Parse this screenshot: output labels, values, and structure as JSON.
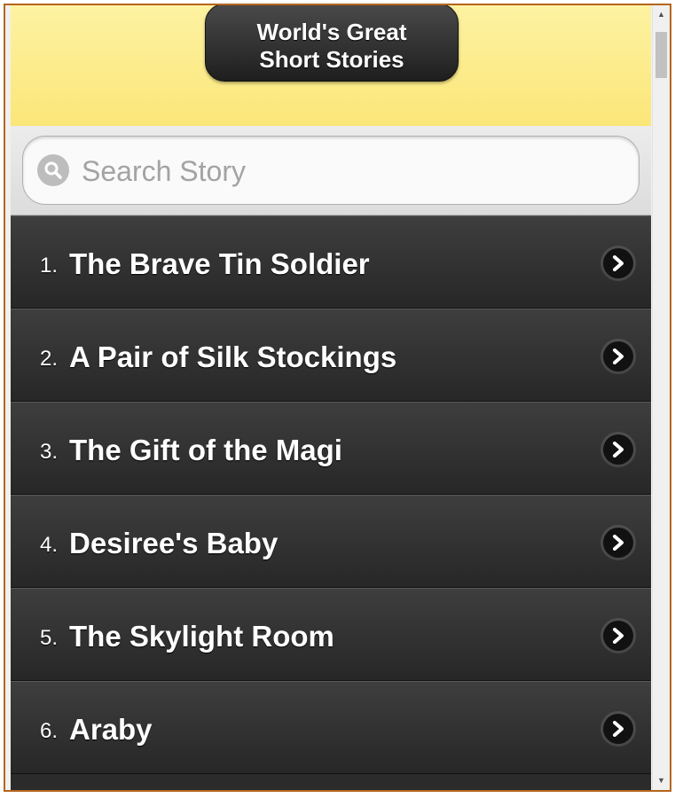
{
  "header": {
    "title": "World's Great\nShort Stories"
  },
  "search": {
    "placeholder": "Search Story",
    "icon": "search-icon"
  },
  "stories": [
    {
      "number": "1.",
      "title": "The Brave Tin Soldier"
    },
    {
      "number": "2.",
      "title": "A Pair of Silk Stockings"
    },
    {
      "number": "3.",
      "title": "The Gift of the Magi"
    },
    {
      "number": "4.",
      "title": "Desiree's Baby"
    },
    {
      "number": "5.",
      "title": "The Skylight Room"
    },
    {
      "number": "6.",
      "title": "Araby"
    }
  ],
  "colors": {
    "header_bg": "#fbe678",
    "list_bg": "#2b2b2b",
    "window_border": "#b5651d"
  }
}
